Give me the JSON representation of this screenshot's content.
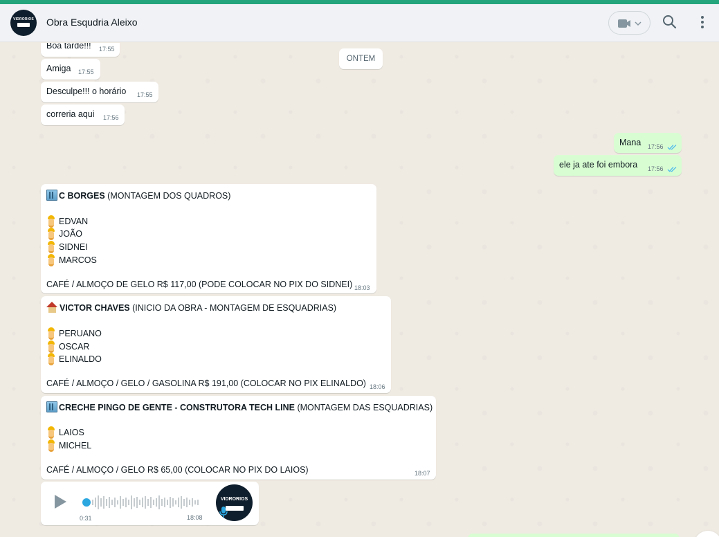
{
  "header": {
    "avatar_brand": "VIDRORIOS",
    "title": "Obra Esqudria Aleixo",
    "video_icon": "video-camera-icon",
    "search_icon": "search-icon",
    "menu_icon": "more-vertical-icon"
  },
  "date_chip": "ONTEM",
  "messages_in_small": [
    {
      "text": "Boa tarde!!!",
      "time": "17:55"
    },
    {
      "text": "Amiga",
      "time": "17:55"
    },
    {
      "text": "Desculpe!!! o horário",
      "time": "17:55"
    },
    {
      "text": "correria aqui",
      "time": "17:56"
    }
  ],
  "messages_out": [
    {
      "text": "Mana",
      "time": "17:56"
    },
    {
      "text": "ele ja ate foi embora",
      "time": "17:56"
    }
  ],
  "crew_messages": [
    {
      "title_bold": "C BORGES",
      "title_rest": "(MONTAGEM DOS QUADROS)",
      "workers": [
        "EDVAN",
        "JOÃO",
        "SIDNEI",
        "MARCOS"
      ],
      "footer": "CAFÉ / ALMOÇO DE GELO R$ 117,00  (PODE COLOCAR NO PIX DO SIDNEI)",
      "time": "18:03"
    },
    {
      "title_bold": "VICTOR CHAVES",
      "title_rest": "(INICIO DA OBRA - MONTAGEM DE ESQUADRIAS)",
      "workers": [
        "PERUANO",
        "OSCAR",
        "ELINALDO"
      ],
      "footer": "CAFÉ / ALMOÇO / GELO / GASOLINA R$ 191,00 (COLOCAR NO PIX ELINALDO)",
      "time": "18:06"
    },
    {
      "title_bold": "CRECHE PINGO DE GENTE - CONSTRUTORA TECH LINE",
      "title_rest": "(MONTAGEM DAS ESQUADRIAS)",
      "workers": [
        "LAIOS",
        "MICHEL"
      ],
      "footer": "CAFÉ / ALMOÇO / GELO R$ 65,00 (COLOCAR NO PIX DO LAIOS)",
      "time": "18:07"
    }
  ],
  "audio": {
    "duration": "0:31",
    "time": "18:08",
    "avatar_brand": "VIDRORIOS"
  },
  "colors": {
    "accent": "#25a57c",
    "outgoing": "#d9fdd3",
    "chat_bg": "#efeae2",
    "tick_blue": "#53bdeb"
  }
}
